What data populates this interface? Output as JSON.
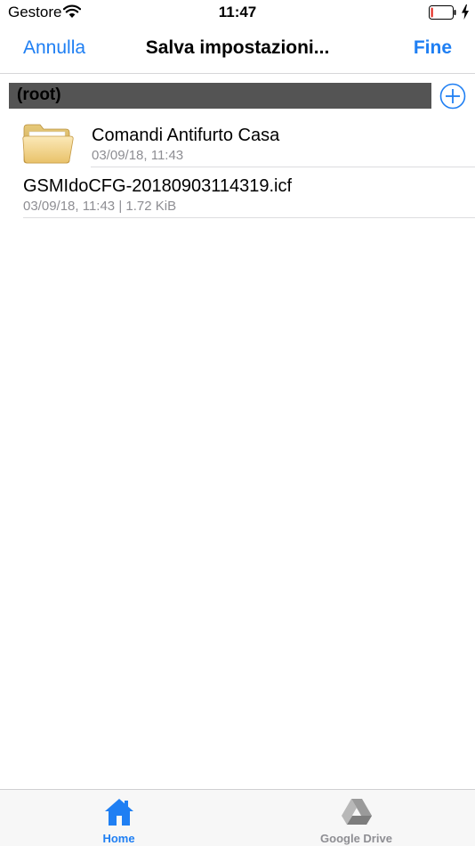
{
  "status_bar": {
    "carrier": "Gestore",
    "time": "11:47",
    "battery_level": 0.1
  },
  "nav": {
    "cancel_label": "Annulla",
    "title": "Salva impostazioni...",
    "done_label": "Fine"
  },
  "path": {
    "label": "(root)"
  },
  "items": [
    {
      "name": "Comandi Antifurto Casa",
      "meta": "03/09/18, 11:43",
      "icon": "folder-icon"
    },
    {
      "name": "GSMIdoCFG-20180903114319.icf",
      "meta": "03/09/18, 11:43 | 1.72 KiB",
      "icon": ""
    }
  ],
  "tabs": [
    {
      "label": "Home",
      "icon": "home-icon",
      "selected": true
    },
    {
      "label": "Google Drive",
      "icon": "google-drive-icon",
      "selected": false
    }
  ],
  "colors": {
    "accent": "#1f7ff3",
    "path_bar": "#545454",
    "secondary_text": "#8e8e93",
    "battery_low": "#e5332a"
  }
}
